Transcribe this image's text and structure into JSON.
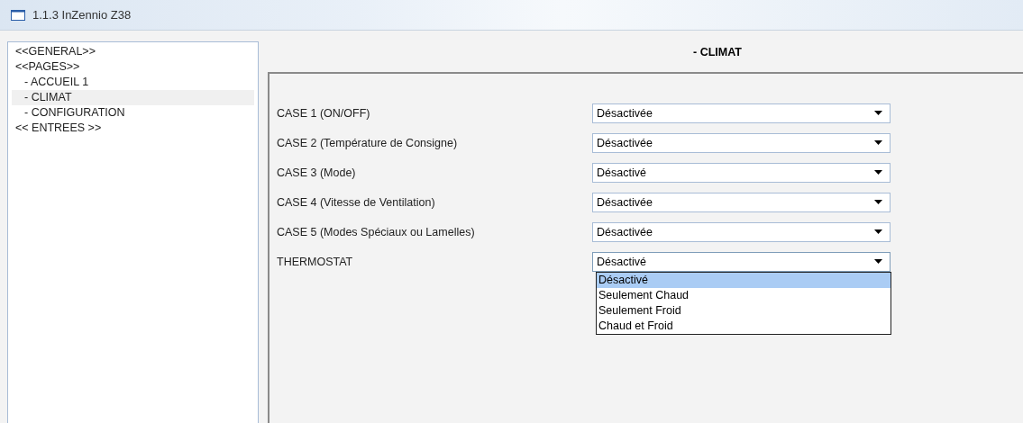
{
  "window": {
    "title": "1.1.3 InZennio Z38"
  },
  "tree": [
    {
      "label": "<<GENERAL>>",
      "selected": false
    },
    {
      "label": "<<PAGES>>",
      "selected": false,
      "children": [
        {
          "label": "- ACCUEIL 1",
          "selected": false
        },
        {
          "label": "- CLIMAT",
          "selected": true
        },
        {
          "label": "- CONFIGURATION",
          "selected": false
        }
      ]
    },
    {
      "label": "<< ENTREES >>",
      "selected": false
    }
  ],
  "section": {
    "title": "- CLIMAT"
  },
  "fields": [
    {
      "label": "CASE 1 (ON/OFF)",
      "value": "Désactivée",
      "expanded": false
    },
    {
      "label": "CASE 2 (Température de Consigne)",
      "value": "Désactivée",
      "expanded": false
    },
    {
      "label": "CASE 3 (Mode)",
      "value": "Désactivé",
      "expanded": false
    },
    {
      "label": "CASE 4 (Vitesse de Ventilation)",
      "value": "Désactivée",
      "expanded": false
    },
    {
      "label": "CASE 5 (Modes Spéciaux ou Lamelles)",
      "value": "Désactivée",
      "expanded": false
    },
    {
      "label": "THERMOSTAT",
      "value": "Désactivé",
      "expanded": true,
      "options": [
        {
          "label": "Désactivé",
          "selected": true
        },
        {
          "label": "Seulement Chaud",
          "selected": false
        },
        {
          "label": "Seulement Froid",
          "selected": false
        },
        {
          "label": "Chaud et Froid",
          "selected": false
        }
      ]
    }
  ]
}
